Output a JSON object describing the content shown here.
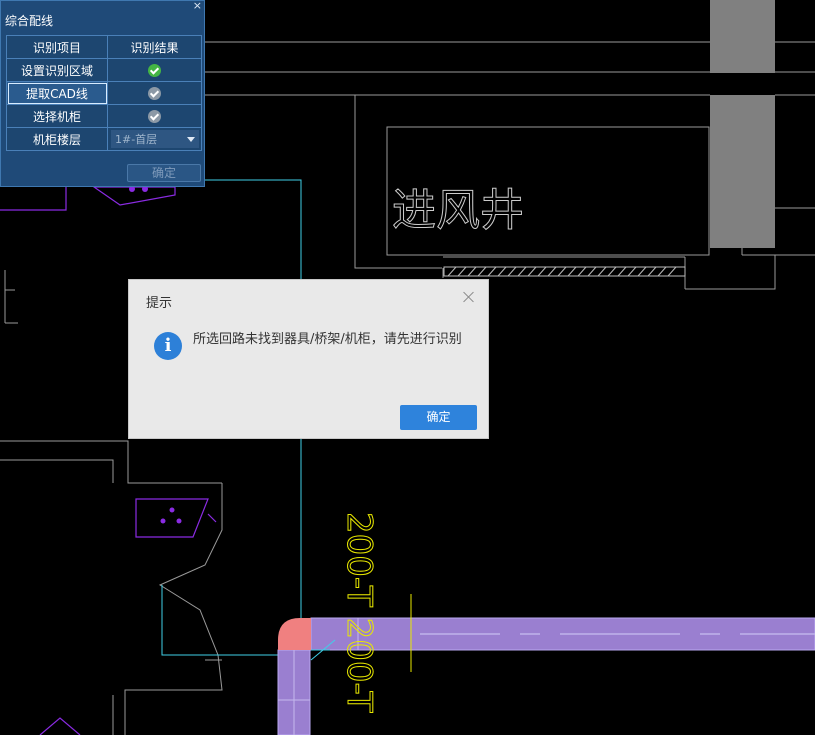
{
  "panel": {
    "title": "综合配线",
    "close_glyph": "×",
    "headers": [
      "识别项目",
      "识别结果"
    ],
    "rows": [
      {
        "label": "设置识别区域",
        "status": "complete"
      },
      {
        "label": "提取CAD线",
        "status": "pending",
        "selected": true
      },
      {
        "label": "选择机柜",
        "status": "pending"
      }
    ],
    "floor": {
      "label": "机柜楼层",
      "value": "1#-首层"
    },
    "confirm_label": "确定"
  },
  "dialog": {
    "title": "提示",
    "message": "所选回路未找到器具/桥架/机柜，请先进行识别",
    "ok_label": "确定"
  },
  "cad": {
    "room_text": "进风井",
    "pipe_label": "200-T 200-T",
    "colors": {
      "wall": "#9a9a9a",
      "column": "#808080",
      "cyan_line": "#3fd0e8",
      "purple_outline": "#8a2be2",
      "tray_fill": "#9a7fd0",
      "tray_corner": "#f08080",
      "yellow_text": "#e8e800"
    }
  }
}
